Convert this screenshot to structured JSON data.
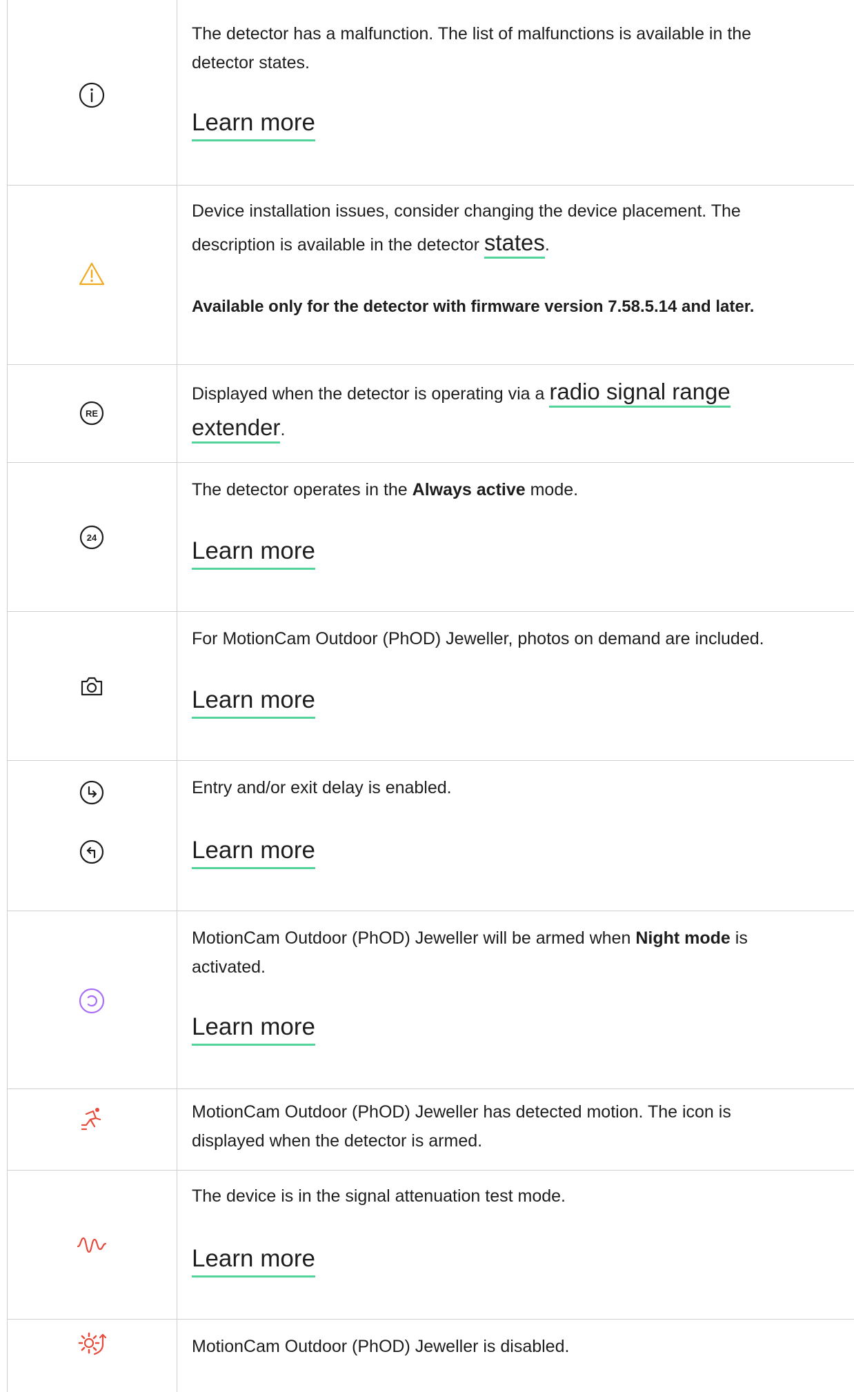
{
  "rows": [
    {
      "icon": "info-circle-icon",
      "text1": "The detector has a malfunction. The list of malfunctions is available in the",
      "text2": "detector states.",
      "link": "Learn more"
    },
    {
      "icon": "warning-triangle-icon",
      "text1": "Device installation issues, consider changing the device placement. The",
      "text2_pre": "description is available in the detector ",
      "text2_link": "states",
      "text2_post": ".",
      "note": "Available only for the detector with firmware version 7.58.5.14 and later."
    },
    {
      "icon": "range-extender-icon",
      "icon_label": "RE",
      "text1_pre": "Displayed when the detector is operating via a ",
      "text1_link": "radio signal range",
      "text2_link": "extender",
      "text2_post": "."
    },
    {
      "icon": "always-active-icon",
      "icon_label": "24",
      "text_pre": "The detector operates in the ",
      "text_bold": "Always active",
      "text_post": " mode.",
      "link": "Learn more"
    },
    {
      "icon": "camera-icon",
      "text": "For MotionCam Outdoor (PhOD) Jeweller, photos on demand are included.",
      "link": "Learn more"
    },
    {
      "icon": "delay-icons",
      "text": "Entry and/or exit delay is enabled.",
      "link": "Learn more"
    },
    {
      "icon": "night-mode-icon",
      "text1_pre": "MotionCam Outdoor (PhOD) Jeweller will be armed when ",
      "text1_bold": "Night mode",
      "text1_post": " is",
      "text2": "activated.",
      "link": "Learn more"
    },
    {
      "icon": "motion-detected-icon",
      "text1": "MotionCam Outdoor (PhOD) Jeweller has detected motion. The icon is",
      "text2": "displayed when the detector is armed."
    },
    {
      "icon": "signal-test-icon",
      "text": "The device is in the signal attenuation test mode.",
      "link": "Learn more"
    },
    {
      "icon": "device-disabled-icon",
      "text": "MotionCam Outdoor (PhOD) Jeweller is disabled."
    }
  ],
  "colors": {
    "link_underline": "#52d39a",
    "warning": "#f0a81c",
    "night_mode": "#a86ef7",
    "alert": "#e64a3b",
    "border": "#cfcfcf"
  }
}
